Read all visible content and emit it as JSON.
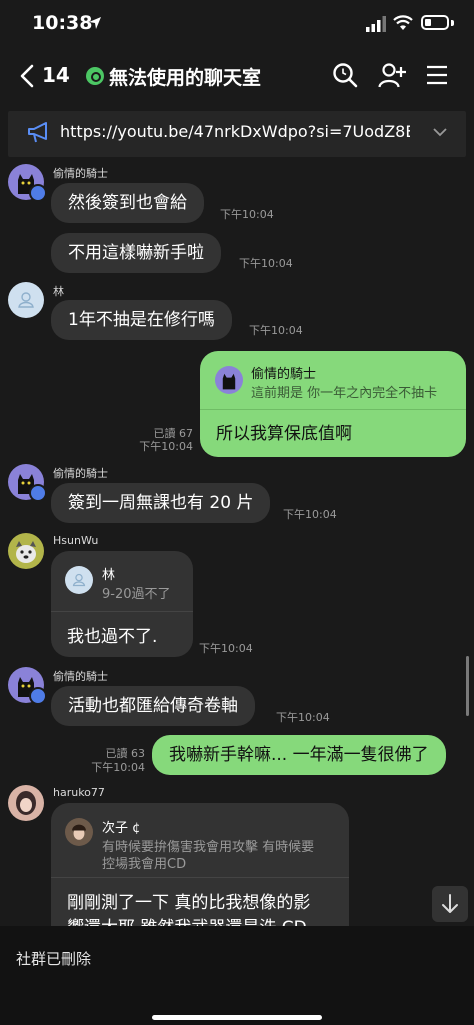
{
  "status_bar": {
    "time": "10:38"
  },
  "header": {
    "back_count": "14",
    "title": "無法使用的聊天室"
  },
  "announcement": {
    "text": "https://youtu.be/47nrkDxWdpo?si=7UodZ8E..."
  },
  "messages": [
    {
      "sender": "偷情的騎士",
      "text": "然後簽到也會給",
      "time": "下午10:04"
    },
    {
      "text": "不用這樣嚇新手啦",
      "time": "下午10:04"
    },
    {
      "sender": "林",
      "text": "1年不抽是在修行嗎",
      "time": "下午10:04"
    },
    {
      "outgoing": true,
      "read": "已讀 67",
      "time": "下午10:04",
      "quote_name": "偷情的騎士",
      "quote_text": "這前期是 你一年之內完全不抽卡",
      "text": "所以我算保底值啊"
    },
    {
      "sender": "偷情的騎士",
      "text": "簽到一周無課也有 20 片",
      "time": "下午10:04"
    },
    {
      "sender": "HsunWu",
      "quote_name": "林",
      "quote_text": "9-20過不了",
      "text": "我也過不了.",
      "time": "下午10:04"
    },
    {
      "sender": "偷情的騎士",
      "text": "活動也都匯給傳奇卷軸",
      "time": "下午10:04"
    },
    {
      "outgoing": true,
      "read": "已讀 63",
      "time": "下午10:04",
      "text": "我嚇新手幹嘛... 一年滿一隻很佛了"
    },
    {
      "sender": "haruko77",
      "quote_name": "次子 ¢",
      "quote_text_1": "有時候要拚傷害我會用攻擊 有時候要",
      "quote_text_2": "控場我會用CD",
      "text_1": "剛剛測了一下 真的比我想像的影",
      "text_2": "響還大耶 雖然我武器還是洗 CD"
    }
  ],
  "footer": {
    "closed_text": "社群已刪除"
  }
}
